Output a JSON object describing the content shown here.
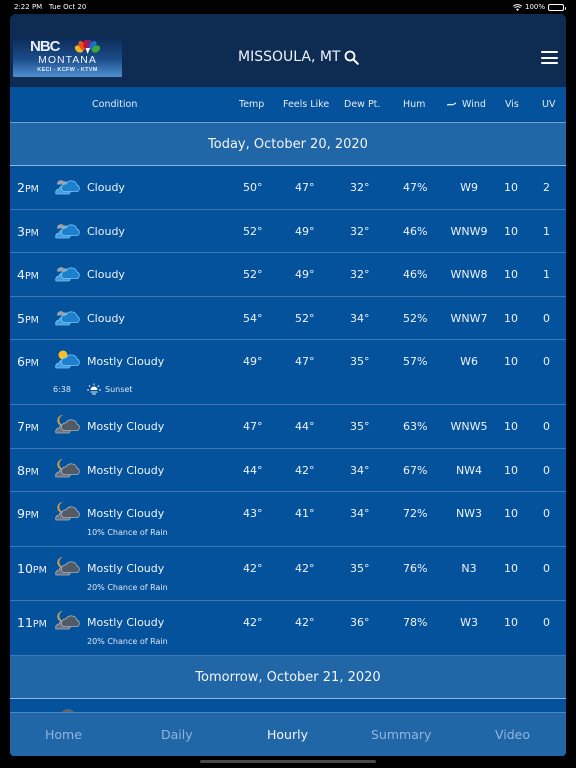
{
  "status_bar": {
    "time": "2:22 PM",
    "date": "Tue Oct 20",
    "battery": "100%",
    "battery_level": 1.0
  },
  "header": {
    "logo": {
      "brand": "NBC",
      "name": "MONTANA",
      "callsigns": "KECI - KCFW - KTVM"
    },
    "location": "MISSOULA, MT",
    "search_icon": "search-icon",
    "menu_icon": "hamburger-menu-icon"
  },
  "columns": {
    "condition": "Condition",
    "temp": "Temp",
    "feels_like": "Feels Like",
    "dew_pt": "Dew Pt.",
    "hum": "Hum",
    "wind": "Wind",
    "wind_icon": "wind-icon",
    "vis": "Vis",
    "uv": "UV"
  },
  "days": [
    {
      "label": "Today, October 20, 2020",
      "rows": [
        {
          "hour": "2",
          "ampm": "PM",
          "icon": "cloudy-day",
          "condition": "Cloudy",
          "temp": "50°",
          "feels": "47°",
          "dew": "32°",
          "hum": "47%",
          "wind": "W9",
          "vis": "10",
          "uv": "2"
        },
        {
          "hour": "3",
          "ampm": "PM",
          "icon": "cloudy-day",
          "condition": "Cloudy",
          "temp": "52°",
          "feels": "49°",
          "dew": "32°",
          "hum": "46%",
          "wind": "WNW9",
          "vis": "10",
          "uv": "1"
        },
        {
          "hour": "4",
          "ampm": "PM",
          "icon": "cloudy-day",
          "condition": "Cloudy",
          "temp": "52°",
          "feels": "49°",
          "dew": "32°",
          "hum": "46%",
          "wind": "WNW8",
          "vis": "10",
          "uv": "1"
        },
        {
          "hour": "5",
          "ampm": "PM",
          "icon": "cloudy-day",
          "condition": "Cloudy",
          "temp": "54°",
          "feels": "52°",
          "dew": "34°",
          "hum": "52%",
          "wind": "WNW7",
          "vis": "10",
          "uv": "0"
        },
        {
          "hour": "6",
          "ampm": "PM",
          "icon": "mostly-cloudy-day",
          "condition": "Mostly Cloudy",
          "temp": "49°",
          "feels": "47°",
          "dew": "35°",
          "hum": "57%",
          "wind": "W6",
          "vis": "10",
          "uv": "0",
          "sunset": {
            "time": "6:38",
            "label": "Sunset"
          }
        },
        {
          "hour": "7",
          "ampm": "PM",
          "icon": "mostly-cloudy-night",
          "condition": "Mostly Cloudy",
          "temp": "47°",
          "feels": "44°",
          "dew": "35°",
          "hum": "63%",
          "wind": "WNW5",
          "vis": "10",
          "uv": "0"
        },
        {
          "hour": "8",
          "ampm": "PM",
          "icon": "mostly-cloudy-night",
          "condition": "Mostly Cloudy",
          "temp": "44°",
          "feels": "42°",
          "dew": "34°",
          "hum": "67%",
          "wind": "NW4",
          "vis": "10",
          "uv": "0"
        },
        {
          "hour": "9",
          "ampm": "PM",
          "icon": "mostly-cloudy-night",
          "condition": "Mostly Cloudy",
          "temp": "43°",
          "feels": "41°",
          "dew": "34°",
          "hum": "72%",
          "wind": "NW3",
          "vis": "10",
          "uv": "0",
          "note": "10% Chance of Rain"
        },
        {
          "hour": "10",
          "ampm": "PM",
          "icon": "mostly-cloudy-night",
          "condition": "Mostly Cloudy",
          "temp": "42°",
          "feels": "42°",
          "dew": "35°",
          "hum": "76%",
          "wind": "N3",
          "vis": "10",
          "uv": "0",
          "note": "20% Chance of Rain"
        },
        {
          "hour": "11",
          "ampm": "PM",
          "icon": "mostly-cloudy-night",
          "condition": "Mostly Cloudy",
          "temp": "42°",
          "feels": "42°",
          "dew": "36°",
          "hum": "78%",
          "wind": "W3",
          "vis": "10",
          "uv": "0",
          "note": "20% Chance of Rain"
        }
      ]
    },
    {
      "label": "Tomorrow, October 21, 2020",
      "rows": []
    }
  ],
  "tabs": [
    {
      "label": "Home",
      "active": false
    },
    {
      "label": "Daily",
      "active": false
    },
    {
      "label": "Hourly",
      "active": true
    },
    {
      "label": "Summary",
      "active": false
    },
    {
      "label": "Video",
      "active": false
    }
  ],
  "colors": {
    "header_bg": "#0e2c52",
    "table_bg": "#05529c",
    "day_header_bg": "#2166a6",
    "tab_active": "#f4f7fb",
    "tab_inactive": "#8fb6de"
  }
}
